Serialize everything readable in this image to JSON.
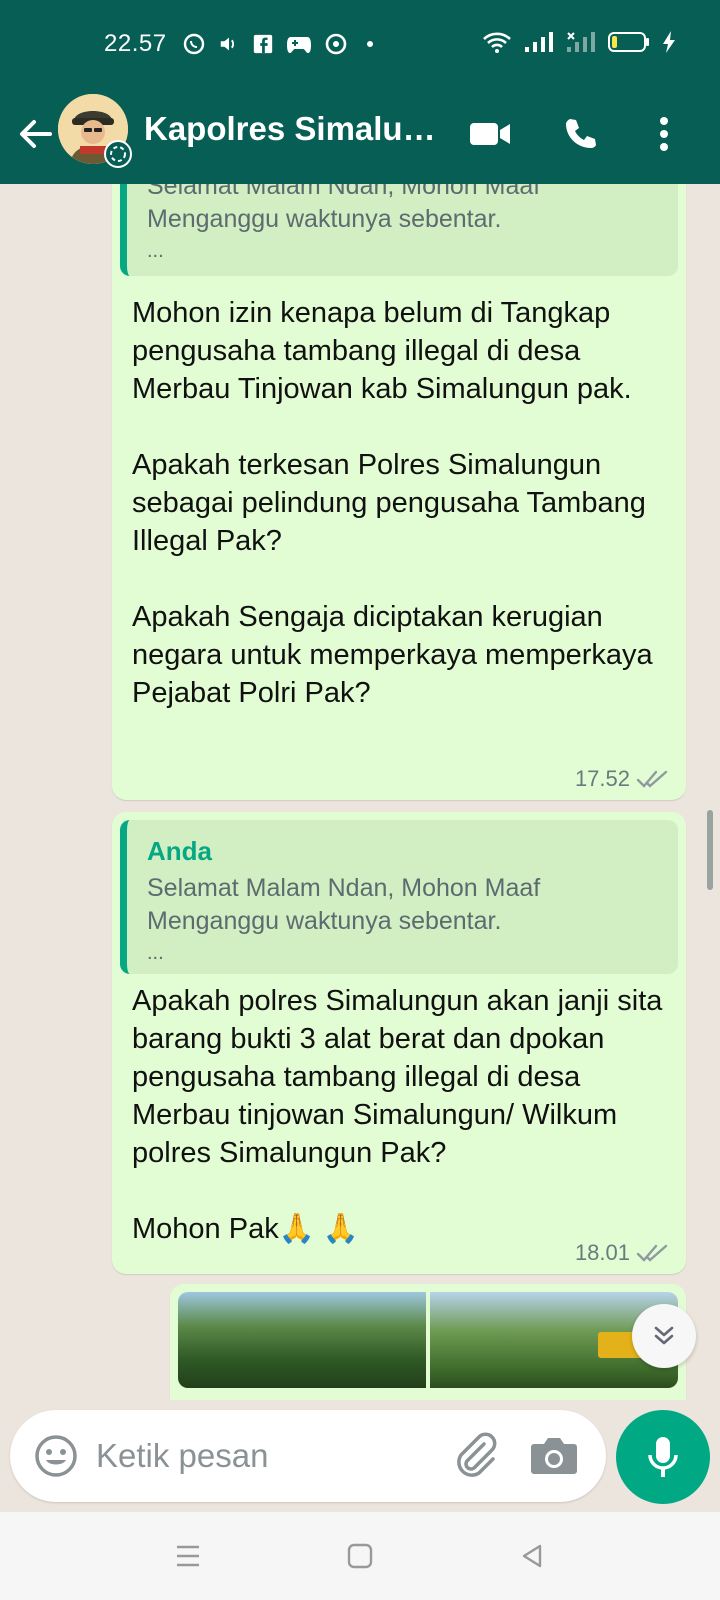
{
  "status_bar": {
    "time": "22.57",
    "icons": [
      "whatsapp-icon",
      "volume-icon",
      "facebook-icon",
      "gamepad-icon",
      "location-icon",
      "dot-icon",
      "wifi-icon",
      "signal-icon",
      "signal-x-icon",
      "battery-icon",
      "charging-icon"
    ]
  },
  "header": {
    "contact_name": "Kapolres Simalungun",
    "icons": [
      "back-arrow-icon",
      "video-call-icon",
      "voice-call-icon",
      "more-options-icon"
    ]
  },
  "messages": [
    {
      "quote": {
        "author": "",
        "text": "Selamat Malam Ndan, Mohon Maaf Menganggu waktunya sebentar.",
        "ellipsis": "..."
      },
      "text": "Mohon izin kenapa belum di Tangkap pengusaha tambang illegal di desa Merbau Tinjowan kab Simalungun pak.\n\nApakah terkesan Polres Simalungun sebagai pelindung pengusaha Tambang Illegal Pak?\n\nApakah Sengaja diciptakan kerugian negara untuk memperkaya memperkaya Pejabat Polri Pak?",
      "time": "17.52"
    },
    {
      "quote": {
        "author": "Anda",
        "text": "Selamat Malam Ndan, Mohon Maaf Menganggu waktunya sebentar.",
        "ellipsis": "..."
      },
      "text": "Apakah polres Simalungun akan janji sita barang bukti 3 alat berat dan dpokan pengusaha tambang illegal di desa Merbau tinjowan Simalungun/ Wilkum polres Simalungun Pak?\n\nMohon Pak🙏 🙏",
      "time": "18.01"
    }
  ],
  "composer": {
    "placeholder": "Ketik pesan"
  },
  "colors": {
    "header": "#075e54",
    "outgoing_bubble": "#e2fdd3",
    "quote_bar": "#06a884",
    "chat_bg": "#ece5dd",
    "mic_button": "#00a884"
  }
}
